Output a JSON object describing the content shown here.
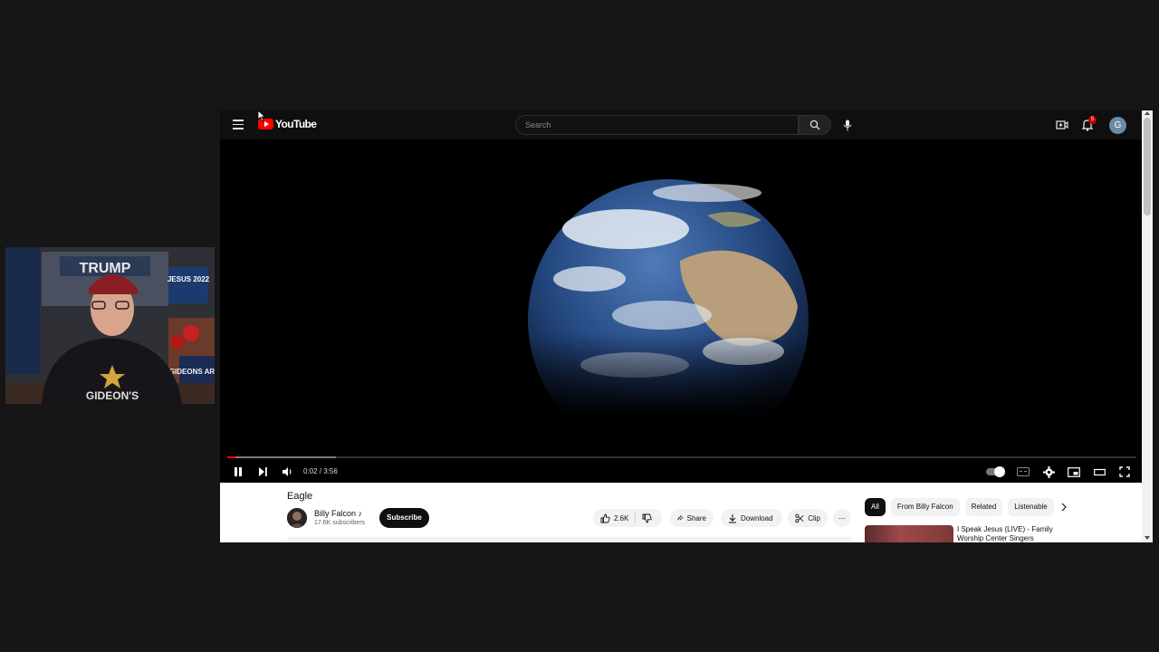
{
  "header": {
    "logo_text": "YouTube",
    "search_placeholder": "Search",
    "notification_count": "5",
    "account_initial": "G"
  },
  "player": {
    "time_display": "0:02 / 3:56",
    "progress_fraction": 0.0085,
    "buffered_fraction": 0.12
  },
  "video": {
    "title": "Eagle",
    "channel_name": "Billy Falcon ♪",
    "subscribers": "17.6K subscribers",
    "subscribe_label": "Subscribe",
    "like_count": "2.6K",
    "share_label": "Share",
    "download_label": "Download",
    "clip_label": "Clip",
    "more_label": "⋯"
  },
  "sidebar": {
    "chips": [
      "All",
      "From Billy Falcon",
      "Related",
      "Listenable"
    ],
    "recommendation_title": "I Speak Jesus (LIVE) - Family Worship Center Singers"
  },
  "webcam": {
    "shirt_text": "GIDEON'S",
    "banner_text": "TRUMP",
    "sign_text": "JESUS 2022",
    "flag_text": "GIDEONS ARMY"
  },
  "colors": {
    "brand_red": "#ff0000",
    "page_bg": "#161616",
    "player_bg": "#000000",
    "panel_bg": "#ffffff"
  }
}
